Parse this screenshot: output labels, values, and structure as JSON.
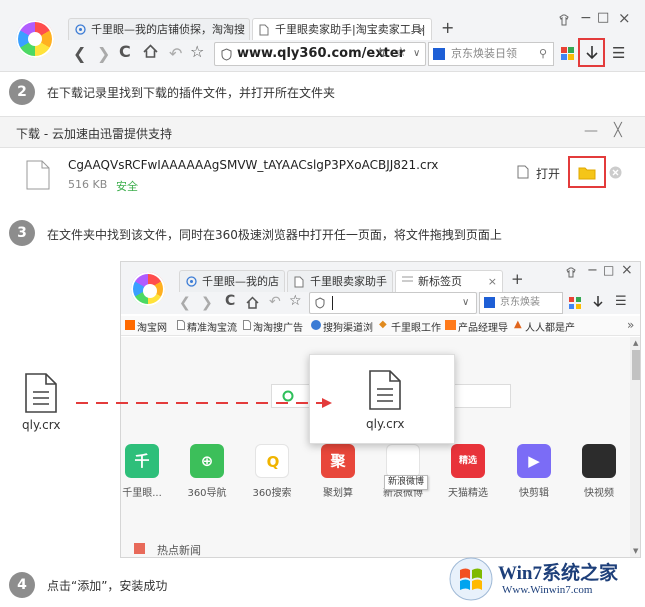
{
  "top_browser": {
    "tabs": [
      {
        "label": "千里眼—我的店铺侦探，淘淘搜"
      },
      {
        "label": "千里眼卖家助手|淘宝卖家工具|"
      }
    ],
    "new_tab": "+",
    "close_x": "×",
    "url": "www.qly360.com/exter",
    "search_placeholder": "京东焕装日领",
    "win_min": "−",
    "win_max": "□",
    "win_close": "×"
  },
  "steps": [
    {
      "num": "2",
      "text": "在下载记录里找到下载的插件文件，并打开所在文件夹"
    },
    {
      "num": "3",
      "text": "在文件夹中找到该文件，同时在360极速浏览器中打开任一页面，将文件拖拽到页面上"
    },
    {
      "num": "4",
      "text": "点击“添加”，安装成功"
    }
  ],
  "download_panel": {
    "title": "下载 - 云加速由迅雷提供支持",
    "file_name": "CgAAQVsRCFwIAAAAAAgSMVW_tAYAACslgP3PXoACBJJ821.crx",
    "file_size": "516 KB",
    "file_status": "安全",
    "open_label": "打开",
    "min": "—",
    "close": "╳"
  },
  "inner_browser": {
    "tabs": [
      {
        "label": "千里眼—我的店"
      },
      {
        "label": "千里眼卖家助手"
      },
      {
        "label": "新标签页"
      }
    ],
    "new_tab": "+",
    "close_x": "×",
    "search_placeholder": "京东焕装",
    "bookmarks": [
      "淘宝网",
      "精准淘宝流",
      "淘淘搜广告",
      "搜狗渠道浏",
      "千里眼工作",
      "产品经理导",
      "人人都是产"
    ],
    "bookmark_more": "»",
    "quick_links": [
      {
        "label": "千里眼...",
        "glyph": "千",
        "color": "#2ebf7a"
      },
      {
        "label": "360导航",
        "glyph": "⊕",
        "color": "#3cbf5a"
      },
      {
        "label": "360搜索",
        "glyph": "Q",
        "color": "#ffffff"
      },
      {
        "label": "聚划算",
        "glyph": "聚",
        "color": "#e8473b"
      },
      {
        "label": "新浪微博",
        "glyph": "",
        "color": "#ffffff"
      },
      {
        "label": "天猫精选",
        "glyph": "精选",
        "color": "#e8333a"
      },
      {
        "label": "快剪辑",
        "glyph": "▶",
        "color": "#7b6cf6"
      },
      {
        "label": "快视频",
        "glyph": "",
        "color": "#2c2c2c"
      }
    ],
    "tooltip": "新浪微博",
    "news_label": "热点新闻",
    "drag_file": "qly.crx"
  },
  "desktop_file": "qly.crx",
  "watermark": {
    "brand": "Win7系统之家",
    "url": "Www.Winwin7.com"
  },
  "colors": {
    "highlight": "#e33b3b",
    "folder": "#f5c518",
    "safe": "#3cae4c",
    "arrow": "#e33b3b"
  }
}
